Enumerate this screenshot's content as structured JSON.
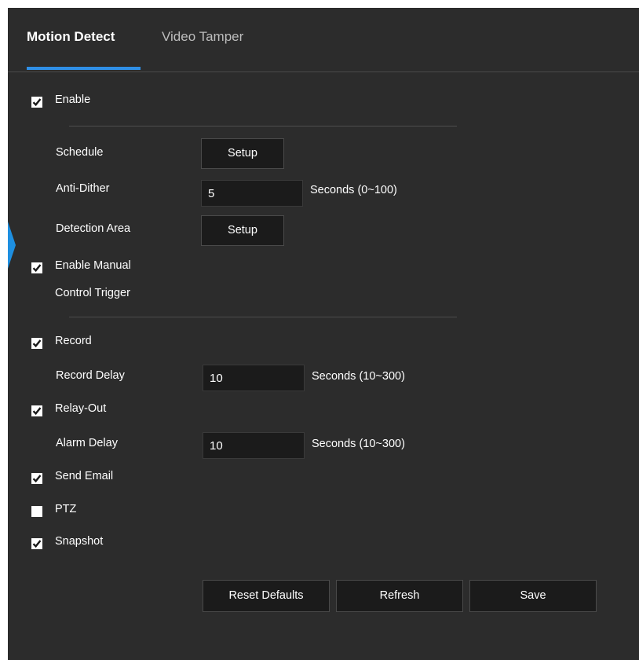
{
  "tabs": [
    {
      "label": "Motion Detect",
      "active": true
    },
    {
      "label": "Video Tamper",
      "active": false
    }
  ],
  "enable": {
    "label": "Enable",
    "checked": true
  },
  "schedule": {
    "label": "Schedule",
    "button": "Setup"
  },
  "anti_dither": {
    "label": "Anti-Dither",
    "value": "5",
    "unit": "Seconds (0~100)"
  },
  "detection_area": {
    "label": "Detection Area",
    "button": "Setup"
  },
  "manual_trigger": {
    "label_line1": "Enable Manual",
    "label_line2": "Control Trigger",
    "checked": true
  },
  "record": {
    "label": "Record",
    "checked": true
  },
  "record_delay": {
    "label": "Record Delay",
    "value": "10",
    "unit": "Seconds (10~300)"
  },
  "relay_out": {
    "label": "Relay-Out",
    "checked": true
  },
  "alarm_delay": {
    "label": "Alarm Delay",
    "value": "10",
    "unit": "Seconds (10~300)"
  },
  "send_email": {
    "label": "Send Email",
    "checked": true
  },
  "ptz": {
    "label": "PTZ",
    "checked": false
  },
  "snapshot": {
    "label": "Snapshot",
    "checked": true
  },
  "footer": {
    "reset_label": "Reset Defaults",
    "refresh_label": "Refresh",
    "save_label": "Save"
  },
  "colors": {
    "background": "#2c2c2c",
    "accent": "#2f8fe6",
    "field": "#1b1b1b"
  }
}
